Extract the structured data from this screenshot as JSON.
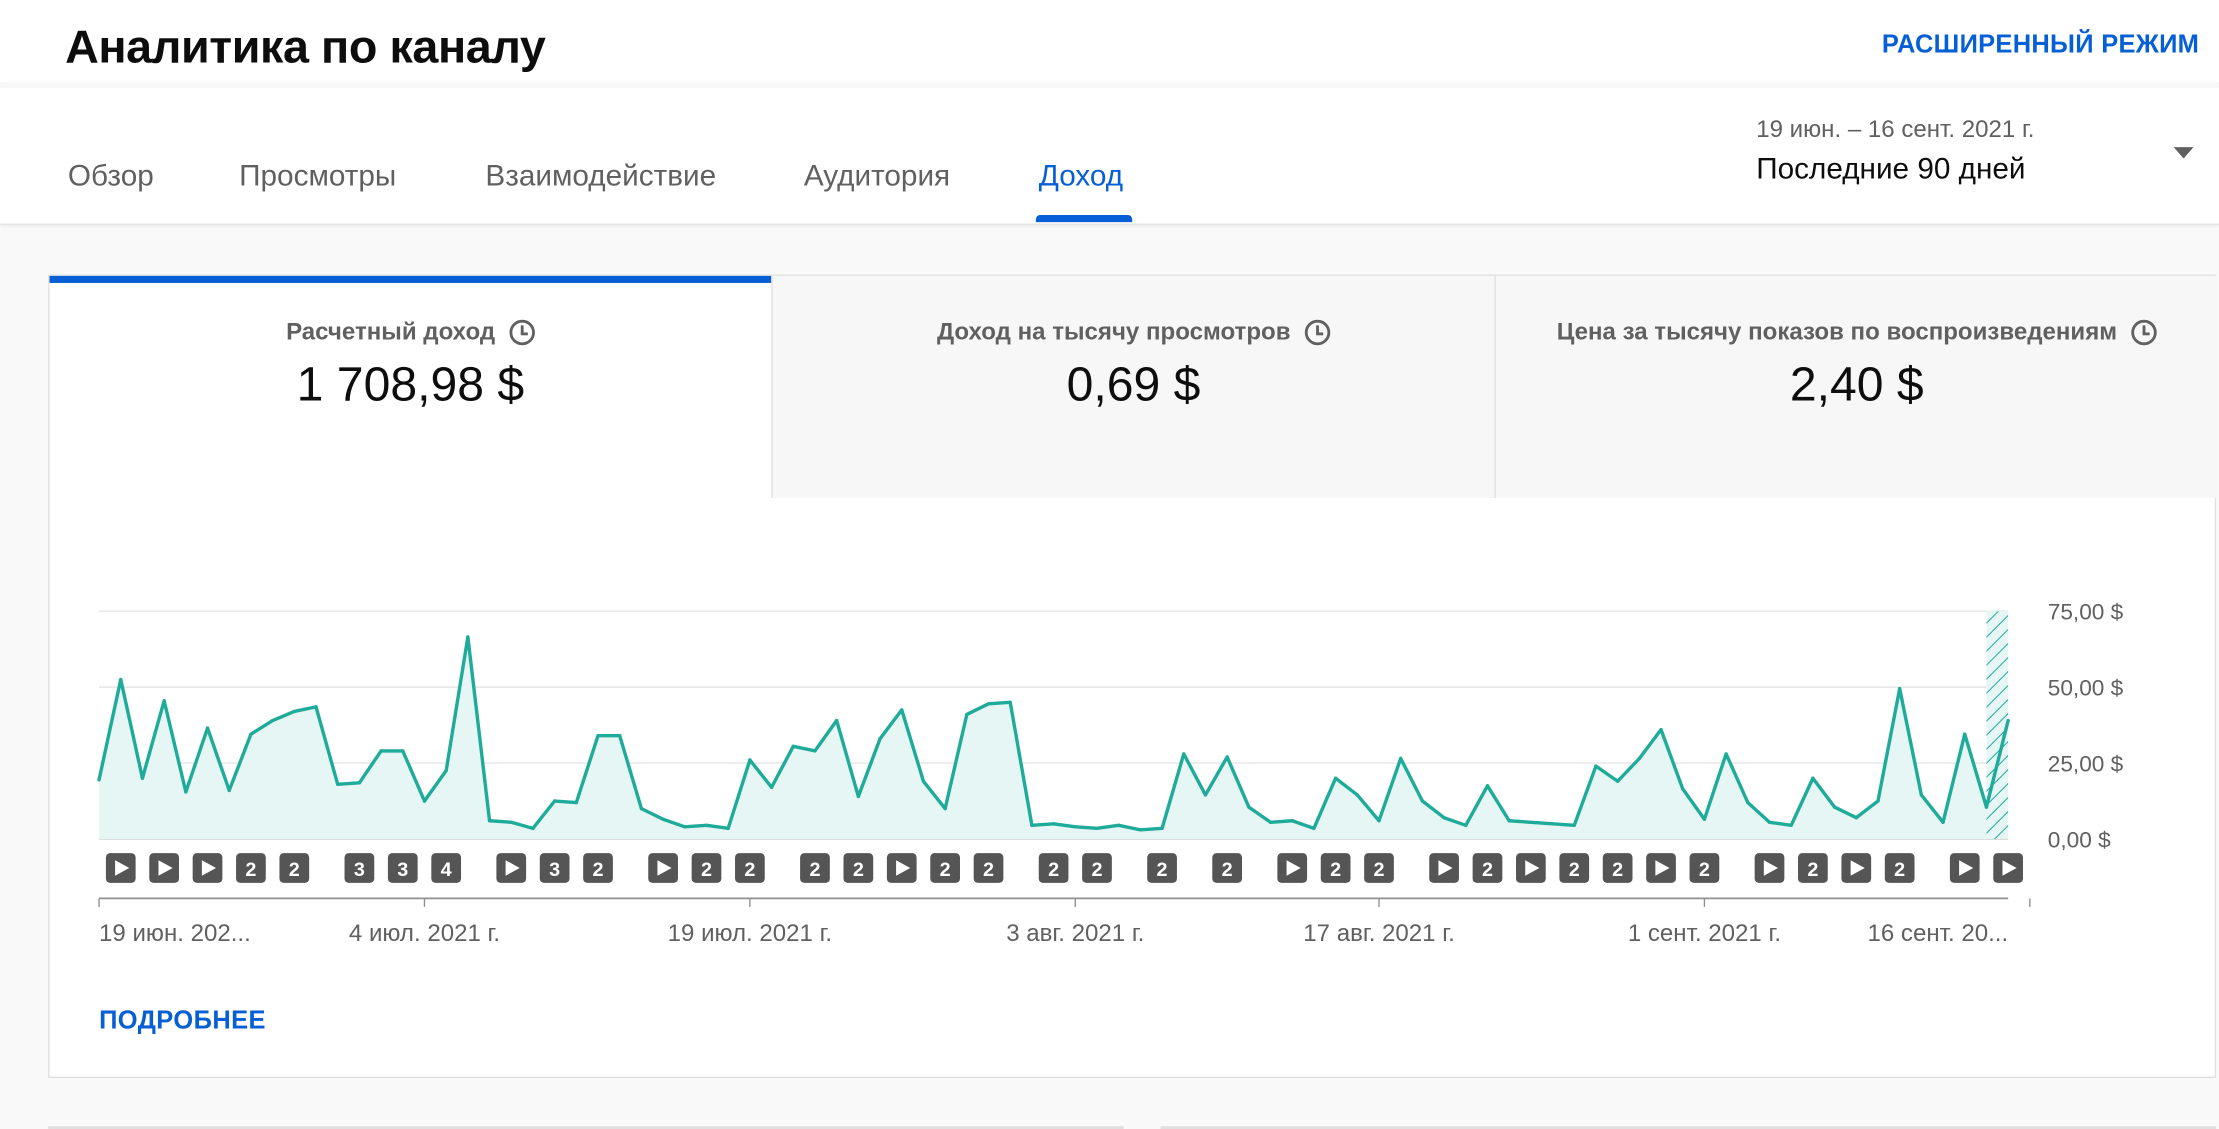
{
  "header": {
    "title": "Аналитика по каналу",
    "advanced_mode": "РАСШИРЕННЫЙ РЕЖИМ"
  },
  "tabs": [
    {
      "label": "Обзор",
      "active": false
    },
    {
      "label": "Просмотры",
      "active": false
    },
    {
      "label": "Взаимодействие",
      "active": false
    },
    {
      "label": "Аудитория",
      "active": false
    },
    {
      "label": "Доход",
      "active": true
    }
  ],
  "date_range": {
    "range": "19 июн. – 16 сент. 2021 г.",
    "label": "Последние 90 дней"
  },
  "metrics": [
    {
      "label": "Расчетный доход",
      "value": "1 708,98 $",
      "active": true
    },
    {
      "label": "Доход на тысячу просмотров",
      "value": "0,69 $",
      "active": false
    },
    {
      "label": "Цена за тысячу показов по воспроизведениям",
      "value": "2,40 $",
      "active": false
    }
  ],
  "more_link": "ПОДРОБНЕЕ",
  "colors": {
    "accent": "#065fd4",
    "line": "#1fab99",
    "fill": "#e6f6f4",
    "marker": "#555555"
  },
  "chart_data": {
    "type": "area",
    "y_unit": "$",
    "ylim": [
      0,
      75
    ],
    "y_ticks": [
      {
        "value": 75,
        "label": "75,00 $"
      },
      {
        "value": 50,
        "label": "50,00 $"
      },
      {
        "value": 25,
        "label": "25,00 $"
      },
      {
        "value": 0,
        "label": "0,00 $"
      }
    ],
    "x_ticks": [
      {
        "index": 0,
        "label": "19 июн. 202..."
      },
      {
        "index": 15,
        "label": "4 июл. 2021 г."
      },
      {
        "index": 30,
        "label": "19 июл. 2021 г."
      },
      {
        "index": 45,
        "label": "3 авг. 2021 г."
      },
      {
        "index": 59,
        "label": "17 авг. 2021 г."
      },
      {
        "index": 74,
        "label": "1 сент. 2021 г."
      },
      {
        "index": 89,
        "label": "16 сент. 20..."
      }
    ],
    "series": [
      {
        "values": [
          19.5,
          52.5,
          20,
          45.5,
          15.5,
          36.5,
          16,
          34.5,
          39,
          42,
          43.5,
          18,
          18.5,
          29,
          29,
          12.5,
          22.5,
          66.5,
          6,
          5.5,
          3.5,
          12.5,
          12,
          34,
          34,
          10,
          6.5,
          4,
          4.5,
          3.5,
          26,
          17,
          30.5,
          29,
          39,
          14,
          33,
          42.5,
          19,
          10,
          41,
          44.5,
          45,
          4.5,
          5,
          4,
          3.5,
          4.5,
          3,
          3.5,
          28,
          14.5,
          27,
          10.5,
          5.5,
          6,
          3.5,
          20,
          14.5,
          6,
          26.5,
          12.5,
          7,
          4.5,
          17.5,
          6,
          5.5,
          5,
          4.5,
          24,
          19,
          26.5,
          36,
          16.5,
          6.5,
          28,
          12,
          5.5,
          4.5,
          20,
          10.5,
          7,
          12.5,
          49.5,
          14.5,
          5.5,
          34.5,
          10.5,
          39
        ]
      }
    ],
    "provisional_last_point": true
  },
  "annotation_markers": [
    {
      "index": 1,
      "type": "play"
    },
    {
      "index": 3,
      "type": "play"
    },
    {
      "index": 5,
      "type": "play"
    },
    {
      "index": 7,
      "type": "count",
      "label": "2"
    },
    {
      "index": 9,
      "type": "count",
      "label": "2"
    },
    {
      "index": 12,
      "type": "count",
      "label": "3"
    },
    {
      "index": 14,
      "type": "count",
      "label": "3"
    },
    {
      "index": 16,
      "type": "count",
      "label": "4"
    },
    {
      "index": 19,
      "type": "play"
    },
    {
      "index": 21,
      "type": "count",
      "label": "3"
    },
    {
      "index": 23,
      "type": "count",
      "label": "2"
    },
    {
      "index": 26,
      "type": "play"
    },
    {
      "index": 28,
      "type": "count",
      "label": "2"
    },
    {
      "index": 30,
      "type": "count",
      "label": "2"
    },
    {
      "index": 33,
      "type": "count",
      "label": "2"
    },
    {
      "index": 35,
      "type": "count",
      "label": "2"
    },
    {
      "index": 37,
      "type": "play"
    },
    {
      "index": 39,
      "type": "count",
      "label": "2"
    },
    {
      "index": 41,
      "type": "count",
      "label": "2"
    },
    {
      "index": 44,
      "type": "count",
      "label": "2"
    },
    {
      "index": 46,
      "type": "count",
      "label": "2"
    },
    {
      "index": 49,
      "type": "count",
      "label": "2"
    },
    {
      "index": 52,
      "type": "count",
      "label": "2"
    },
    {
      "index": 55,
      "type": "play"
    },
    {
      "index": 57,
      "type": "count",
      "label": "2"
    },
    {
      "index": 59,
      "type": "count",
      "label": "2"
    },
    {
      "index": 62,
      "type": "play"
    },
    {
      "index": 64,
      "type": "count",
      "label": "2"
    },
    {
      "index": 66,
      "type": "play"
    },
    {
      "index": 68,
      "type": "count",
      "label": "2"
    },
    {
      "index": 70,
      "type": "count",
      "label": "2"
    },
    {
      "index": 72,
      "type": "play"
    },
    {
      "index": 74,
      "type": "count",
      "label": "2"
    },
    {
      "index": 77,
      "type": "play"
    },
    {
      "index": 79,
      "type": "count",
      "label": "2"
    },
    {
      "index": 81,
      "type": "play"
    },
    {
      "index": 83,
      "type": "count",
      "label": "2"
    },
    {
      "index": 86,
      "type": "play"
    },
    {
      "index": 88,
      "type": "play"
    }
  ]
}
